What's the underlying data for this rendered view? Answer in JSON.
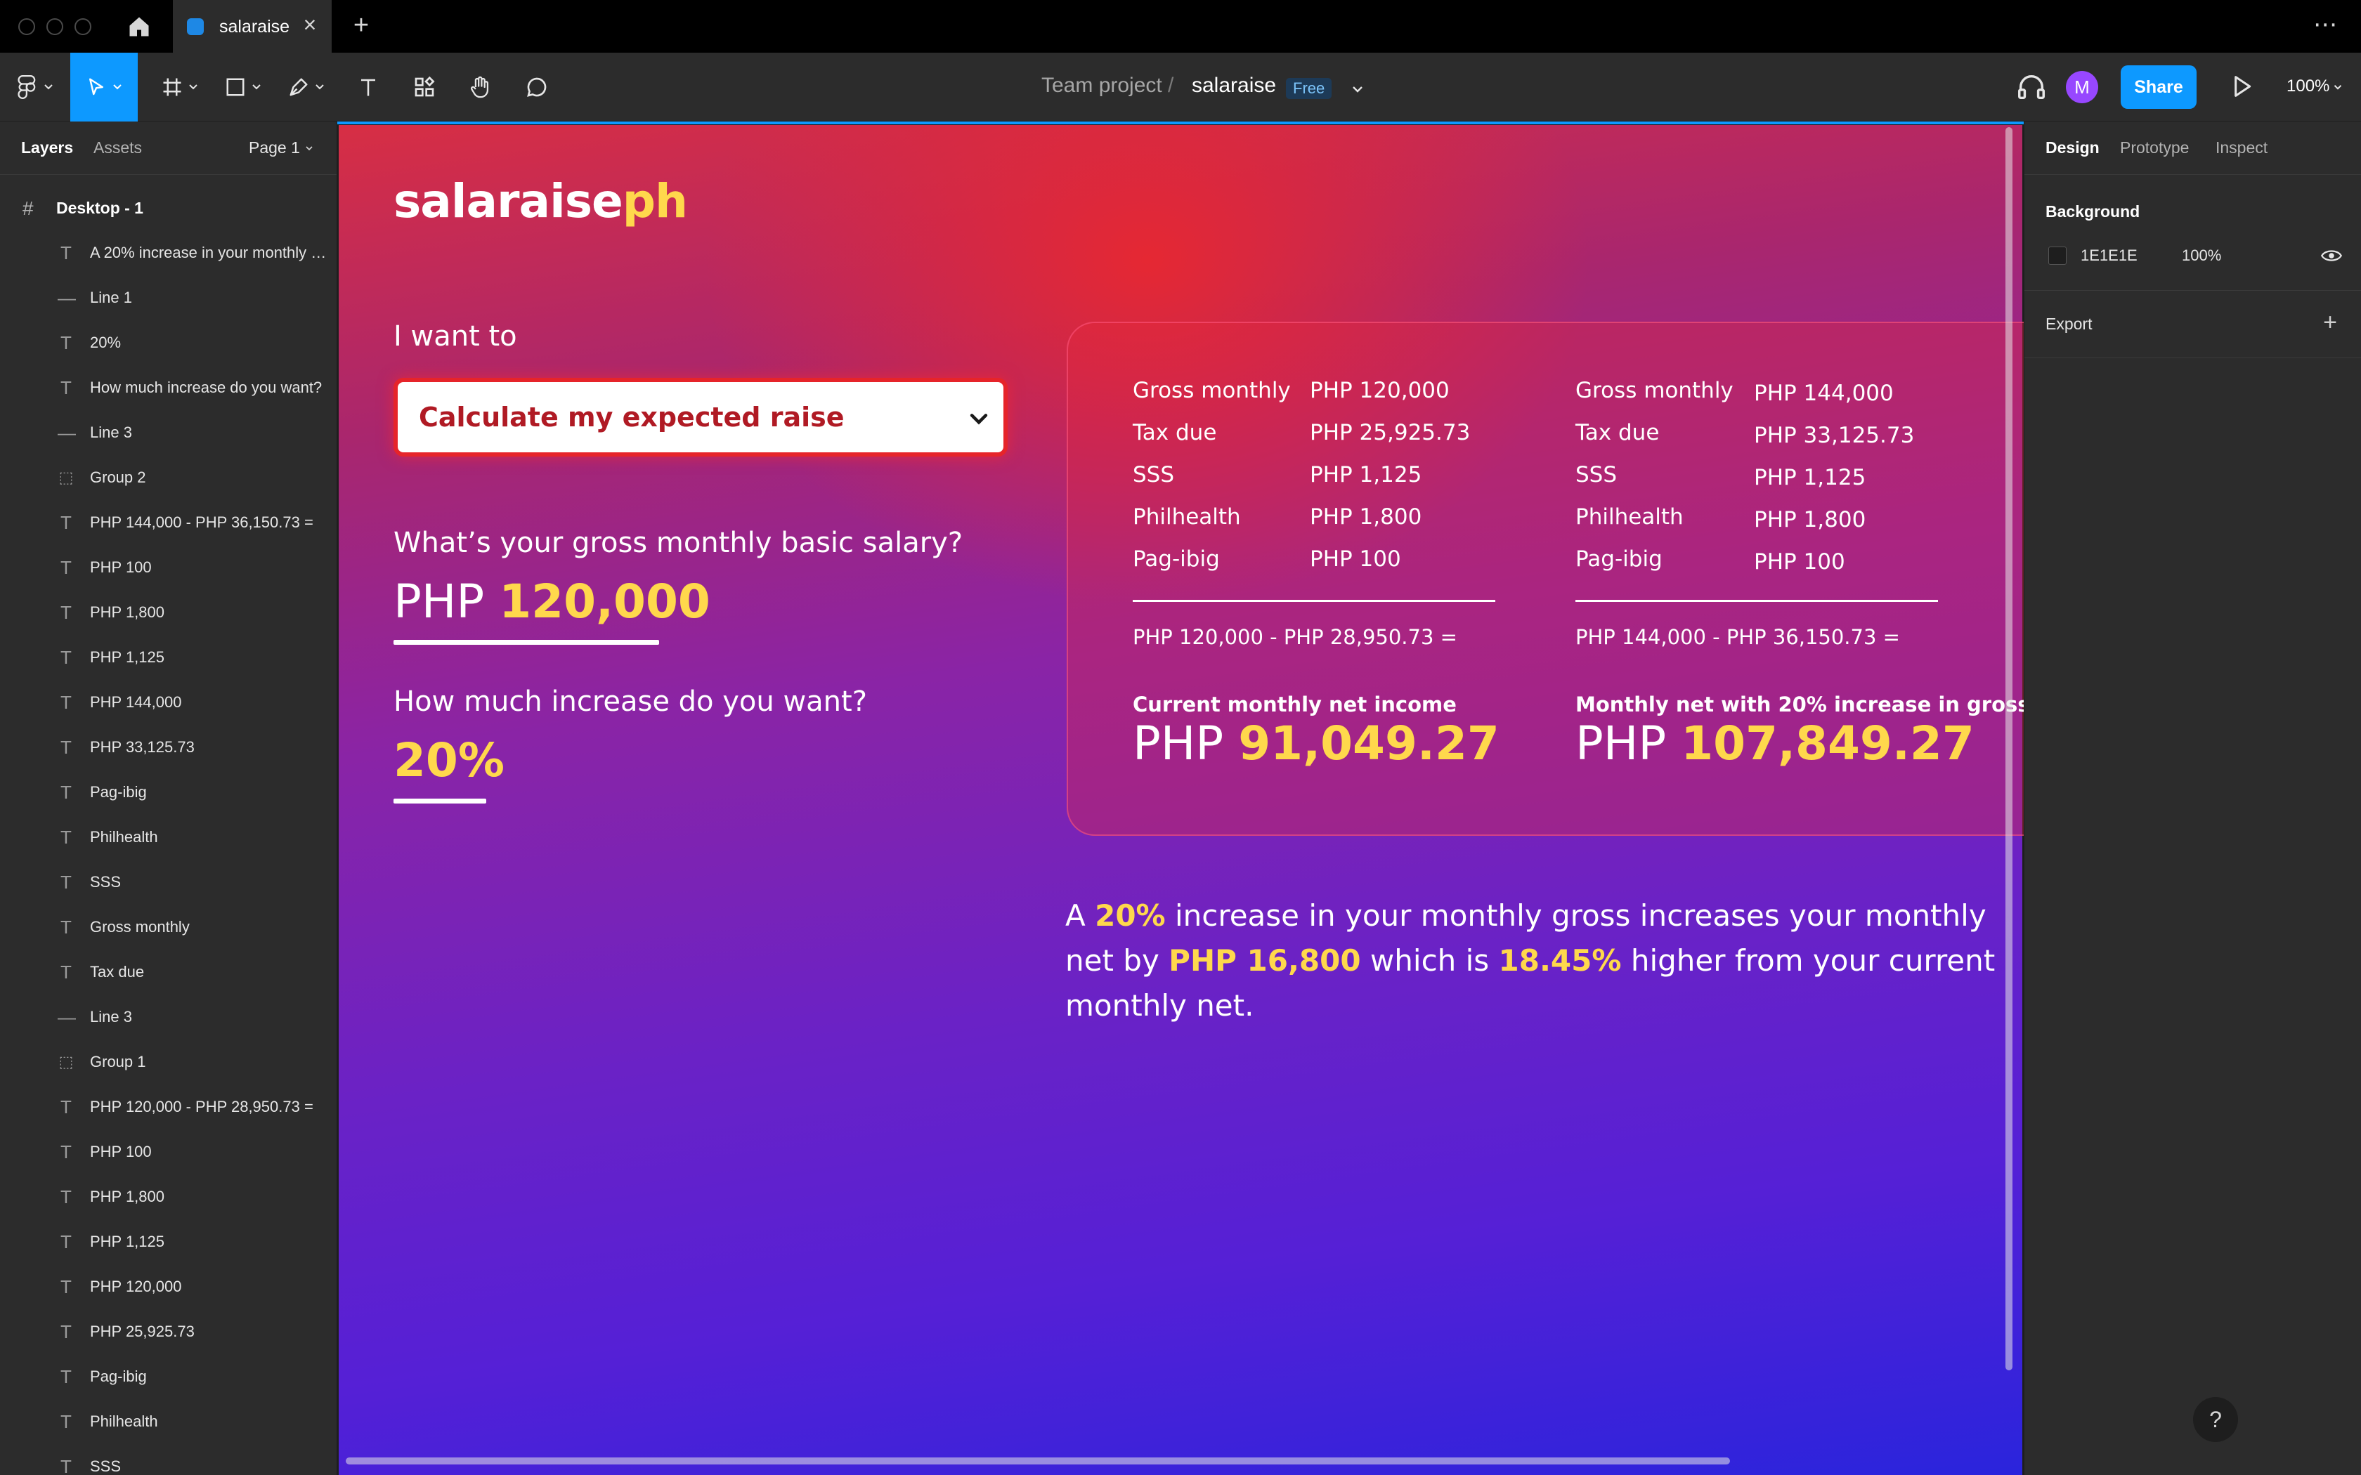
{
  "tabbar": {
    "file_tab_title": "salaraise",
    "close_glyph": "×",
    "new_tab_glyph": "+",
    "more_glyph": "⋯"
  },
  "toolbar": {
    "breadcrumb_team": "Team project",
    "breadcrumb_sep": "/",
    "breadcrumb_file": "salaraise",
    "plan_badge": "Free",
    "avatar_initial": "M",
    "share_label": "Share",
    "zoom_label": "100%"
  },
  "left_panel": {
    "tabs": {
      "layers": "Layers",
      "assets": "Assets"
    },
    "page_label": "Page 1",
    "frame_name": "Desktop - 1",
    "layers": [
      {
        "type": "text",
        "label": "A 20% increase in your monthly gross increases your monthly net by PHP 16,800 which is 18.45% higher from your current monthly net."
      },
      {
        "type": "line",
        "label": "Line 1"
      },
      {
        "type": "text",
        "label": "20%"
      },
      {
        "type": "text",
        "label": "How much increase do you want?"
      },
      {
        "type": "line",
        "label": "Line 3"
      },
      {
        "type": "group",
        "label": "Group 2"
      },
      {
        "type": "text",
        "label": "PHP 144,000 - PHP 36,150.73 ="
      },
      {
        "type": "text",
        "label": "PHP 100"
      },
      {
        "type": "text",
        "label": "PHP 1,800"
      },
      {
        "type": "text",
        "label": "PHP 1,125"
      },
      {
        "type": "text",
        "label": "PHP 144,000"
      },
      {
        "type": "text",
        "label": "PHP 33,125.73"
      },
      {
        "type": "text",
        "label": "Pag-ibig"
      },
      {
        "type": "text",
        "label": "Philhealth"
      },
      {
        "type": "text",
        "label": "SSS"
      },
      {
        "type": "text",
        "label": "Gross monthly"
      },
      {
        "type": "text",
        "label": "Tax due"
      },
      {
        "type": "line",
        "label": "Line 3"
      },
      {
        "type": "group",
        "label": "Group 1"
      },
      {
        "type": "text",
        "label": "PHP 120,000 - PHP 28,950.73 ="
      },
      {
        "type": "text",
        "label": "PHP 100"
      },
      {
        "type": "text",
        "label": "PHP 1,800"
      },
      {
        "type": "text",
        "label": "PHP 1,125"
      },
      {
        "type": "text",
        "label": "PHP 120,000"
      },
      {
        "type": "text",
        "label": "PHP 25,925.73"
      },
      {
        "type": "text",
        "label": "Pag-ibig"
      },
      {
        "type": "text",
        "label": "Philhealth"
      },
      {
        "type": "text",
        "label": "SSS"
      }
    ]
  },
  "design": {
    "logo_white": "salaraise",
    "logo_yellow": "ph",
    "want_label": "I want to",
    "dropdown_value": "Calculate my expected raise",
    "salary_question": "What’s your gross monthly basic salary?",
    "currency": "PHP",
    "salary_amount": "120,000",
    "increase_question": "How much increase do you want?",
    "increase_value": "20%",
    "current_column": {
      "rows": [
        {
          "label": "Gross monthly",
          "value": "PHP 120,000"
        },
        {
          "label": "Tax due",
          "value": "PHP 25,925.73"
        },
        {
          "label": "SSS",
          "value": "PHP 1,125"
        },
        {
          "label": "Philhealth",
          "value": "PHP 1,800"
        },
        {
          "label": "Pag-ibig",
          "value": "PHP 100"
        }
      ],
      "equation": "PHP 120,000 - PHP 28,950.73 =",
      "net_title": "Current monthly net income",
      "net_currency": "PHP",
      "net_amount": "91,049.27"
    },
    "raised_column": {
      "rows": [
        {
          "label": "Gross monthly",
          "value": "PHP 144,000"
        },
        {
          "label": "Tax due",
          "value": "PHP 33,125.73"
        },
        {
          "label": "SSS",
          "value": "PHP 1,125"
        },
        {
          "label": "Philhealth",
          "value": "PHP 1,800"
        },
        {
          "label": "Pag-ibig",
          "value": "PHP 100"
        }
      ],
      "equation": "PHP 144,000 - PHP 36,150.73 =",
      "net_title": "Monthly net with 20% increase in gross",
      "net_currency": "PHP",
      "net_amount": "107,849.27"
    },
    "summary": {
      "t1": "A ",
      "h1": "20%",
      "t2": " increase in your monthly gross increases your monthly net by ",
      "h2": "PHP 16,800",
      "t3": " which is ",
      "h3": "18.45%",
      "t4": " higher from your current monthly net."
    }
  },
  "right_panel": {
    "tabs": {
      "design": "Design",
      "prototype": "Prototype",
      "inspect": "Inspect"
    },
    "background_title": "Background",
    "background_hex": "1E1E1E",
    "background_opacity": "100%",
    "export_title": "Export",
    "help_glyph": "?"
  },
  "colors": {
    "accent": "#0d99ff",
    "highlight_yellow": "#ffd84c",
    "dropdown_text": "#b01a24",
    "avatar": "#9747ff"
  },
  "icons": [
    "home-icon",
    "figma-menu-icon",
    "move-tool-icon",
    "frame-tool-icon",
    "shape-tool-icon",
    "pen-tool-icon",
    "text-tool-icon",
    "resources-icon",
    "hand-tool-icon",
    "comment-icon",
    "headphones-icon",
    "play-icon",
    "eye-icon",
    "chevron-down-icon"
  ]
}
